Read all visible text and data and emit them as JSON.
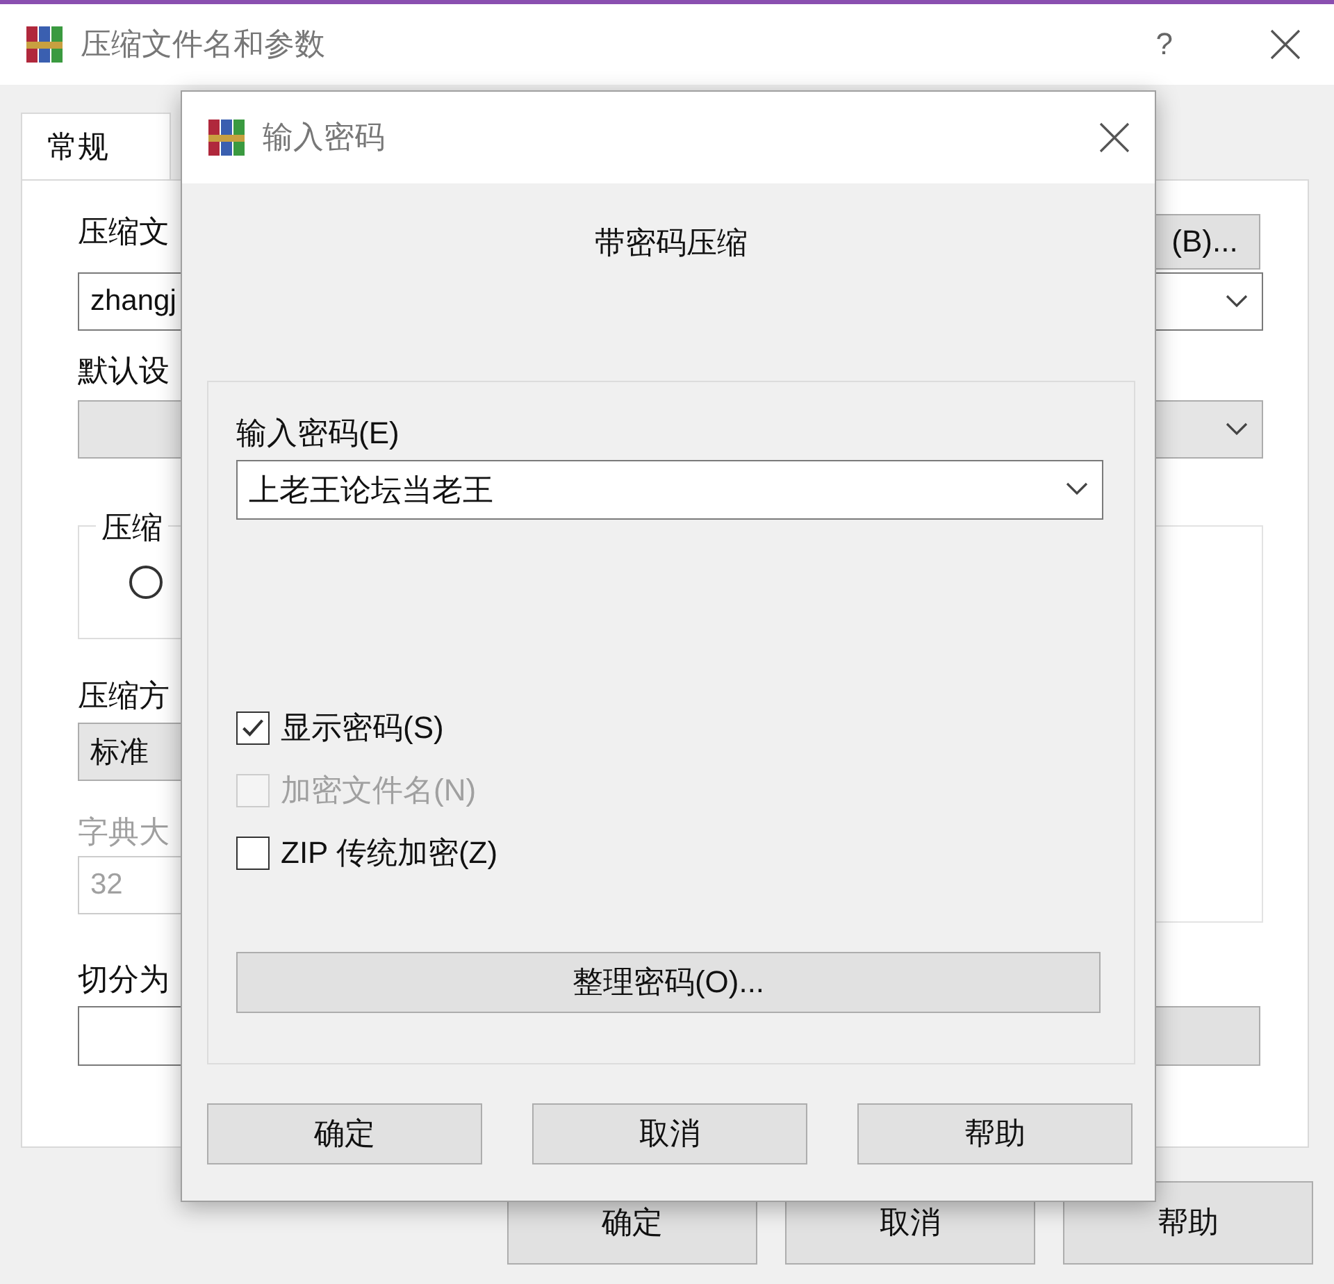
{
  "window": {
    "title": "压缩文件名和参数",
    "help": "?"
  },
  "tabs": [
    {
      "label": "常规",
      "selected": true
    }
  ],
  "general": {
    "archive_name_label": "压缩文",
    "browse_button": "(B)...",
    "archive_name": "zhangj",
    "profile_label": "默认设",
    "format_group_label": "压缩",
    "format_radio": {
      "selected": false
    },
    "method_label": "压缩方",
    "method": "标准",
    "dictionary_label": "字典大",
    "dictionary": "32",
    "dictionary_disabled": true,
    "split_label": "切分为"
  },
  "buttons": [
    "确定",
    "取消",
    "帮助"
  ],
  "password_dialog": {
    "title": "输入密码",
    "heading": "带密码压缩",
    "password_label": "输入密码(E)",
    "password": "上老王论坛当老王",
    "options": [
      {
        "label": "显示密码(S)",
        "checked": true,
        "disabled": false
      },
      {
        "label": "加密文件名(N)",
        "checked": false,
        "disabled": true
      },
      {
        "label": "ZIP 传统加密(Z)",
        "checked": false,
        "disabled": false
      }
    ],
    "organize_button": "整理密码(O)...",
    "buttons": [
      "确定",
      "取消",
      "帮助"
    ]
  }
}
